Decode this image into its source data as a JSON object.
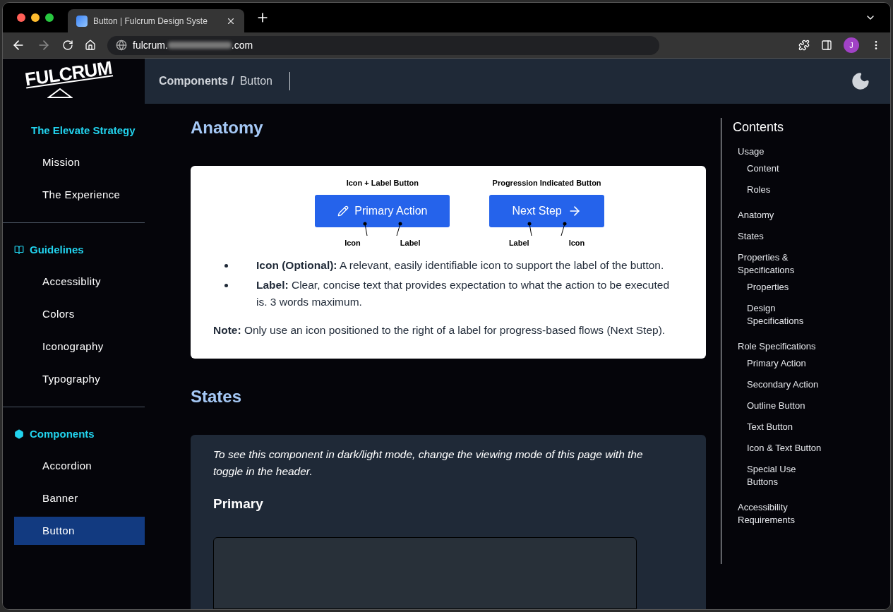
{
  "browser": {
    "tab_title": "Button | Fulcrum Design Syste",
    "url_prefix": "fulcrum.",
    "url_suffix": ".com",
    "profile_initial": "J"
  },
  "sidebar": {
    "logo": "FULCRUM",
    "sections": [
      {
        "title": "The Elevate Strategy",
        "kind": "plain",
        "items": [
          {
            "label": "Mission",
            "selected": false
          },
          {
            "label": "The Experience",
            "selected": false
          }
        ]
      },
      {
        "title": "Guidelines",
        "kind": "book",
        "items": [
          {
            "label": "Accessiblity",
            "selected": false
          },
          {
            "label": "Colors",
            "selected": false
          },
          {
            "label": "Iconography",
            "selected": false
          },
          {
            "label": "Typography",
            "selected": false
          }
        ]
      },
      {
        "title": "Components",
        "kind": "hexagon",
        "items": [
          {
            "label": "Accordion",
            "selected": false
          },
          {
            "label": "Banner",
            "selected": false
          },
          {
            "label": "Button",
            "selected": true
          }
        ]
      }
    ]
  },
  "header": {
    "breadcrumb_parent": "Components /",
    "breadcrumb_current": "Button"
  },
  "anatomy": {
    "title": "Anatomy",
    "examples": [
      {
        "caption": "Icon + Label Button",
        "label": "Primary Action",
        "kind": "icon_left",
        "callouts": [
          "Icon",
          "Label"
        ]
      },
      {
        "caption": "Progression Indicated Button",
        "label": "Next Step",
        "kind": "icon_right",
        "callouts": [
          "Label",
          "Icon"
        ]
      }
    ],
    "bullets": [
      "**Icon (Optional):** A relevant, easily identifiable icon to support the label of the button.",
      "**Label:** Clear, concise text that provides expectation to what the action to be executed is. 3 words maximum."
    ],
    "note": "**Note:** Only use an icon positioned to the right of a label for progress-based flows (Next Step)."
  },
  "states": {
    "title": "States",
    "hint": "To see this component in dark/light mode, change the viewing mode of this page with the toggle in the header.",
    "subtitle": "Primary"
  },
  "contents": {
    "title": "Contents",
    "items": [
      {
        "label": "Usage",
        "children": [
          {
            "label": "Content"
          },
          {
            "label": "Roles"
          }
        ]
      },
      {
        "label": "Anatomy"
      },
      {
        "label": "States"
      },
      {
        "label": "Properties & Specifications",
        "children": [
          {
            "label": "Properties"
          },
          {
            "label": "Design Specifications"
          }
        ]
      },
      {
        "label": "Role Specifications",
        "children": [
          {
            "label": "Primary Action"
          },
          {
            "label": "Secondary Action"
          },
          {
            "label": "Outline Button"
          },
          {
            "label": "Text Button"
          },
          {
            "label": "Icon & Text Button"
          },
          {
            "label": "Special Use Buttons"
          }
        ]
      },
      {
        "label": "Accessibility Requirements"
      }
    ]
  }
}
